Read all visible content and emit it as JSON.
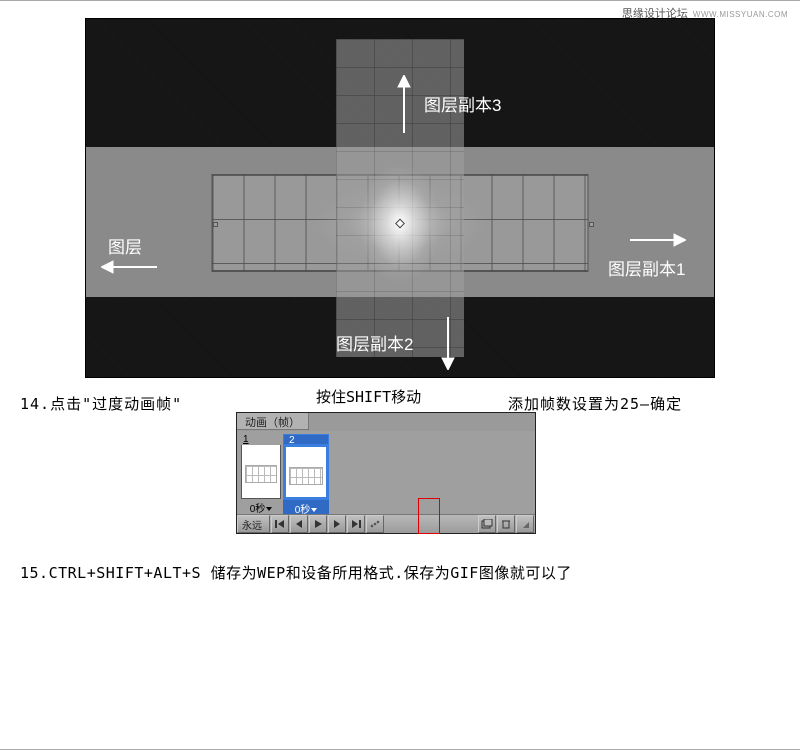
{
  "watermark": {
    "site": "思缘设计论坛",
    "url": "WWW.MISSYUAN.COM"
  },
  "figure": {
    "label_top": "图层副本3",
    "label_bottom": "图层副本2",
    "label_left": "图层",
    "label_right": "图层副本1"
  },
  "caption_mid": "按住SHIFT移动",
  "step14": {
    "left": "14.点击\"过度动画帧\"",
    "right": "添加帧数设置为25—确定"
  },
  "anim_panel": {
    "tab": "动画（帧）",
    "frames": [
      {
        "index": "1",
        "time": "0秒"
      },
      {
        "index": "2",
        "time": "0秒"
      }
    ],
    "loop": "永远"
  },
  "step15": "15.CTRL+SHIFT+ALT+S 储存为WEP和设备所用格式.保存为GIF图像就可以了"
}
